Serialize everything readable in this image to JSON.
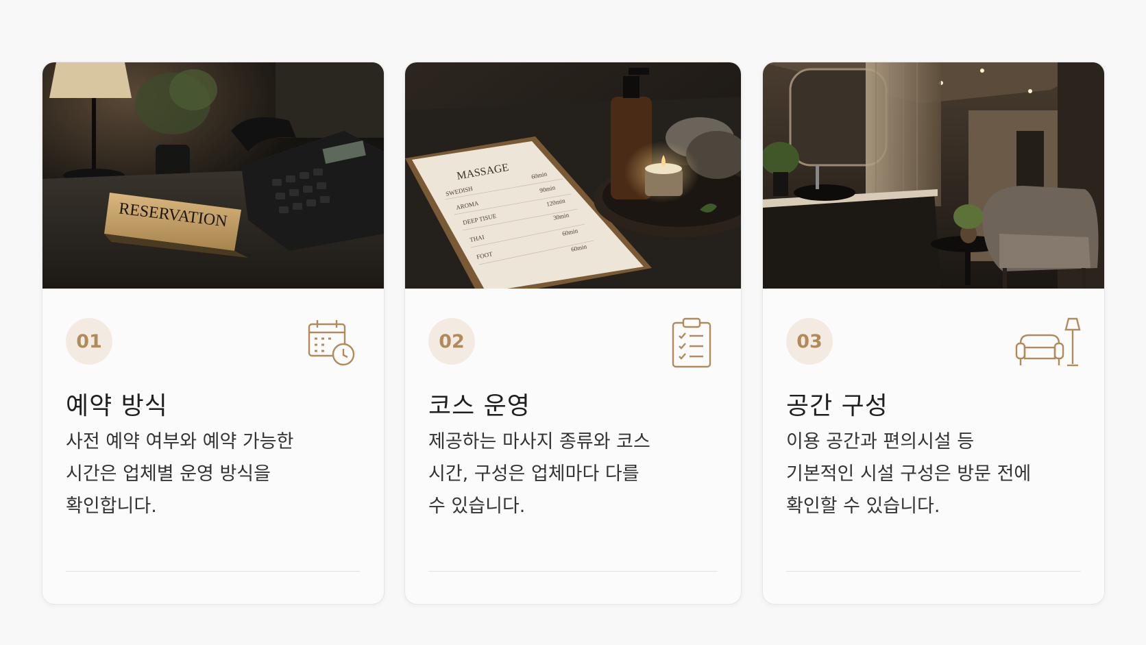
{
  "cards": [
    {
      "number": "01",
      "icon": "calendar-clock-icon",
      "title": "예약 방식",
      "desc_lines": [
        "사전 예약 여부와 예약 가능한",
        "시간은 업체별 운영 방식을",
        "확인합니다."
      ],
      "photo": {
        "sign_text": "RESERVATION"
      }
    },
    {
      "number": "02",
      "icon": "clipboard-checklist-icon",
      "title": "코스 운영",
      "desc_lines": [
        "제공하는 마사지 종류와 코스",
        "시간, 구성은 업체마다 다를",
        "수 있습니다."
      ],
      "photo": {
        "menu_title": "MASSAGE",
        "menu_items": [
          "SWEDISH",
          "AROMA",
          "DEEP TISUE",
          "THAI",
          "FOOT"
        ],
        "menu_times": [
          "60min",
          "90min",
          "120min",
          "30min",
          "60min",
          "60min"
        ]
      }
    },
    {
      "number": "03",
      "icon": "armchair-lamp-icon",
      "title": "공간 구성",
      "desc_lines": [
        "이용 공간과 편의시설 등",
        "기본적인 시설 구성은 방문 전에",
        "확인할 수 있습니다."
      ]
    }
  ],
  "colors": {
    "accent": "#b08a5a",
    "badge_bg": "#f3ebe1",
    "card_bg": "#fbfbfb",
    "page_bg": "#f8f8f8"
  }
}
